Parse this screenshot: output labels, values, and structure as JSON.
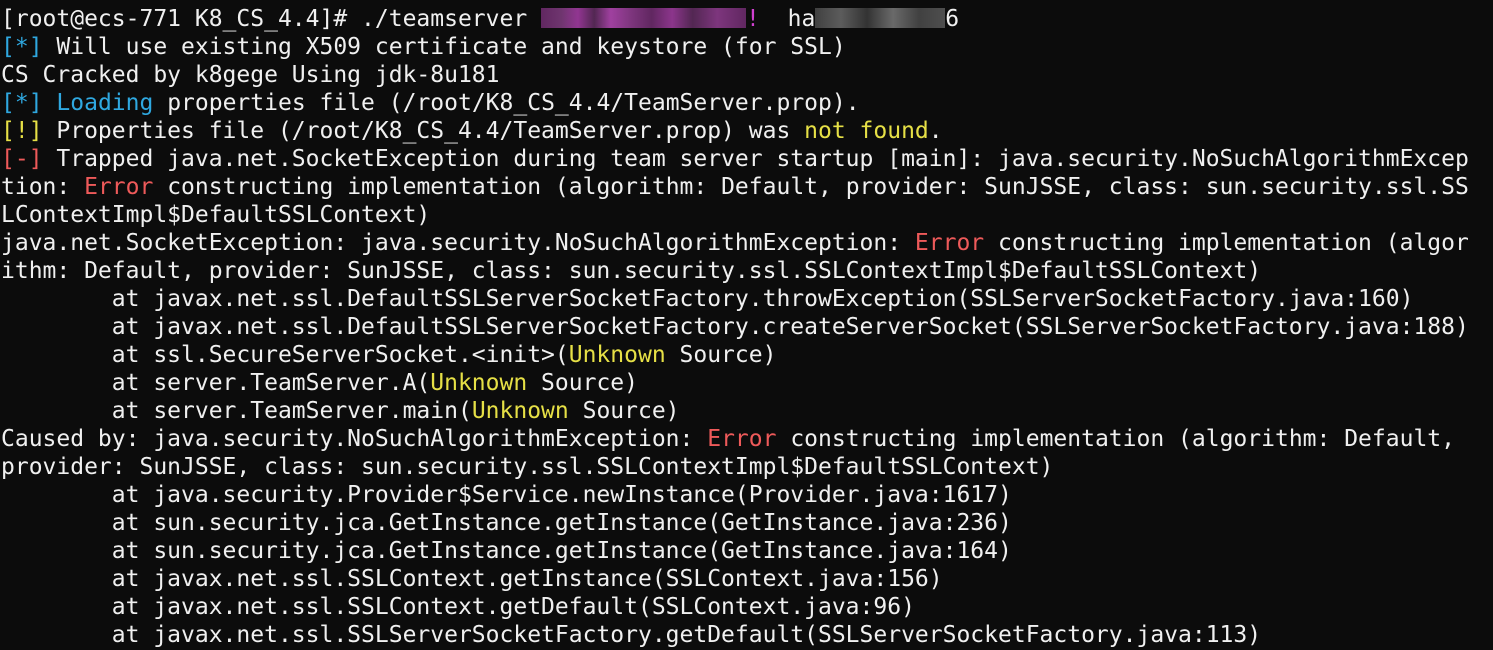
{
  "terminal": {
    "lines": [
      [
        {
          "t": "[root@ecs-771 K8_CS_4.4]# ./teamserver ",
          "c": "text"
        },
        {
          "redact": "purple",
          "w": 205
        },
        {
          "t": "!",
          "c": "bang"
        },
        {
          "t": "  ha",
          "c": "text"
        },
        {
          "redact": "grey",
          "w": 130
        },
        {
          "t": "6",
          "c": "text"
        }
      ],
      [
        {
          "t": "[*]",
          "c": "info"
        },
        {
          "t": " Will use existing X509 certificate and keystore (for SSL)",
          "c": "text"
        }
      ],
      [
        {
          "t": "CS Cracked by k8gege Using jdk-8u181",
          "c": "text"
        }
      ],
      [
        {
          "t": "[*]",
          "c": "info"
        },
        {
          "t": " ",
          "c": "text"
        },
        {
          "t": "Loading",
          "c": "info"
        },
        {
          "t": " properties file (/root/K8_CS_4.4/TeamServer.prop).",
          "c": "text"
        }
      ],
      [
        {
          "t": "[!]",
          "c": "warn"
        },
        {
          "t": " Properties file (/root/K8_CS_4.4/TeamServer.prop) was ",
          "c": "text"
        },
        {
          "t": "not found",
          "c": "yellow"
        },
        {
          "t": ".",
          "c": "text"
        }
      ],
      [
        {
          "t": "[-]",
          "c": "err"
        },
        {
          "t": " Trapped java.net.SocketException during team server startup [main]: java.security.NoSuchAlgorithmExcep",
          "c": "text"
        }
      ],
      [
        {
          "t": "tion: ",
          "c": "text"
        },
        {
          "t": "Error",
          "c": "err"
        },
        {
          "t": " constructing implementation (algorithm: Default, provider: SunJSSE, class: sun.security.ssl.SS",
          "c": "text"
        }
      ],
      [
        {
          "t": "LContextImpl$DefaultSSLContext)",
          "c": "text"
        }
      ],
      [
        {
          "t": "java.net.SocketException: java.security.NoSuchAlgorithmException: ",
          "c": "text"
        },
        {
          "t": "Error",
          "c": "err"
        },
        {
          "t": " constructing implementation (algor",
          "c": "text"
        }
      ],
      [
        {
          "t": "ithm: Default, provider: SunJSSE, class: sun.security.ssl.SSLContextImpl$DefaultSSLContext)",
          "c": "text"
        }
      ],
      [
        {
          "t": "        at javax.net.ssl.DefaultSSLServerSocketFactory.throwException(SSLServerSocketFactory.java:160)",
          "c": "text"
        }
      ],
      [
        {
          "t": "        at javax.net.ssl.DefaultSSLServerSocketFactory.createServerSocket(SSLServerSocketFactory.java:188)",
          "c": "text"
        }
      ],
      [
        {
          "t": "        at ssl.SecureServerSocket.<init>(",
          "c": "text"
        },
        {
          "t": "Unknown",
          "c": "yellow"
        },
        {
          "t": " Source)",
          "c": "text"
        }
      ],
      [
        {
          "t": "        at server.TeamServer.A(",
          "c": "text"
        },
        {
          "t": "Unknown",
          "c": "yellow"
        },
        {
          "t": " Source)",
          "c": "text"
        }
      ],
      [
        {
          "t": "        at server.TeamServer.main(",
          "c": "text"
        },
        {
          "t": "Unknown",
          "c": "yellow"
        },
        {
          "t": " Source)",
          "c": "text"
        }
      ],
      [
        {
          "t": "Caused by: java.security.NoSuchAlgorithmException: ",
          "c": "text"
        },
        {
          "t": "Error",
          "c": "err"
        },
        {
          "t": " constructing implementation (algorithm: Default,",
          "c": "text"
        }
      ],
      [
        {
          "t": "provider: SunJSSE, class: sun.security.ssl.SSLContextImpl$DefaultSSLContext)",
          "c": "text"
        }
      ],
      [
        {
          "t": "        at java.security.Provider$Service.newInstance(Provider.java:1617)",
          "c": "text"
        }
      ],
      [
        {
          "t": "        at sun.security.jca.GetInstance.getInstance(GetInstance.java:236)",
          "c": "text"
        }
      ],
      [
        {
          "t": "        at sun.security.jca.GetInstance.getInstance(GetInstance.java:164)",
          "c": "text"
        }
      ],
      [
        {
          "t": "        at javax.net.ssl.SSLContext.getInstance(SSLContext.java:156)",
          "c": "text"
        }
      ],
      [
        {
          "t": "        at javax.net.ssl.SSLContext.getDefault(SSLContext.java:96)",
          "c": "text"
        }
      ],
      [
        {
          "t": "        at javax.net.ssl.SSLServerSocketFactory.getDefault(SSLServerSocketFactory.java:113)",
          "c": "text"
        }
      ]
    ]
  },
  "colors": {
    "background": "#0c0c0c",
    "text": "#f0f0f0",
    "info": "#2fa8e0",
    "warn": "#e6e046",
    "error": "#ee5a5a"
  }
}
